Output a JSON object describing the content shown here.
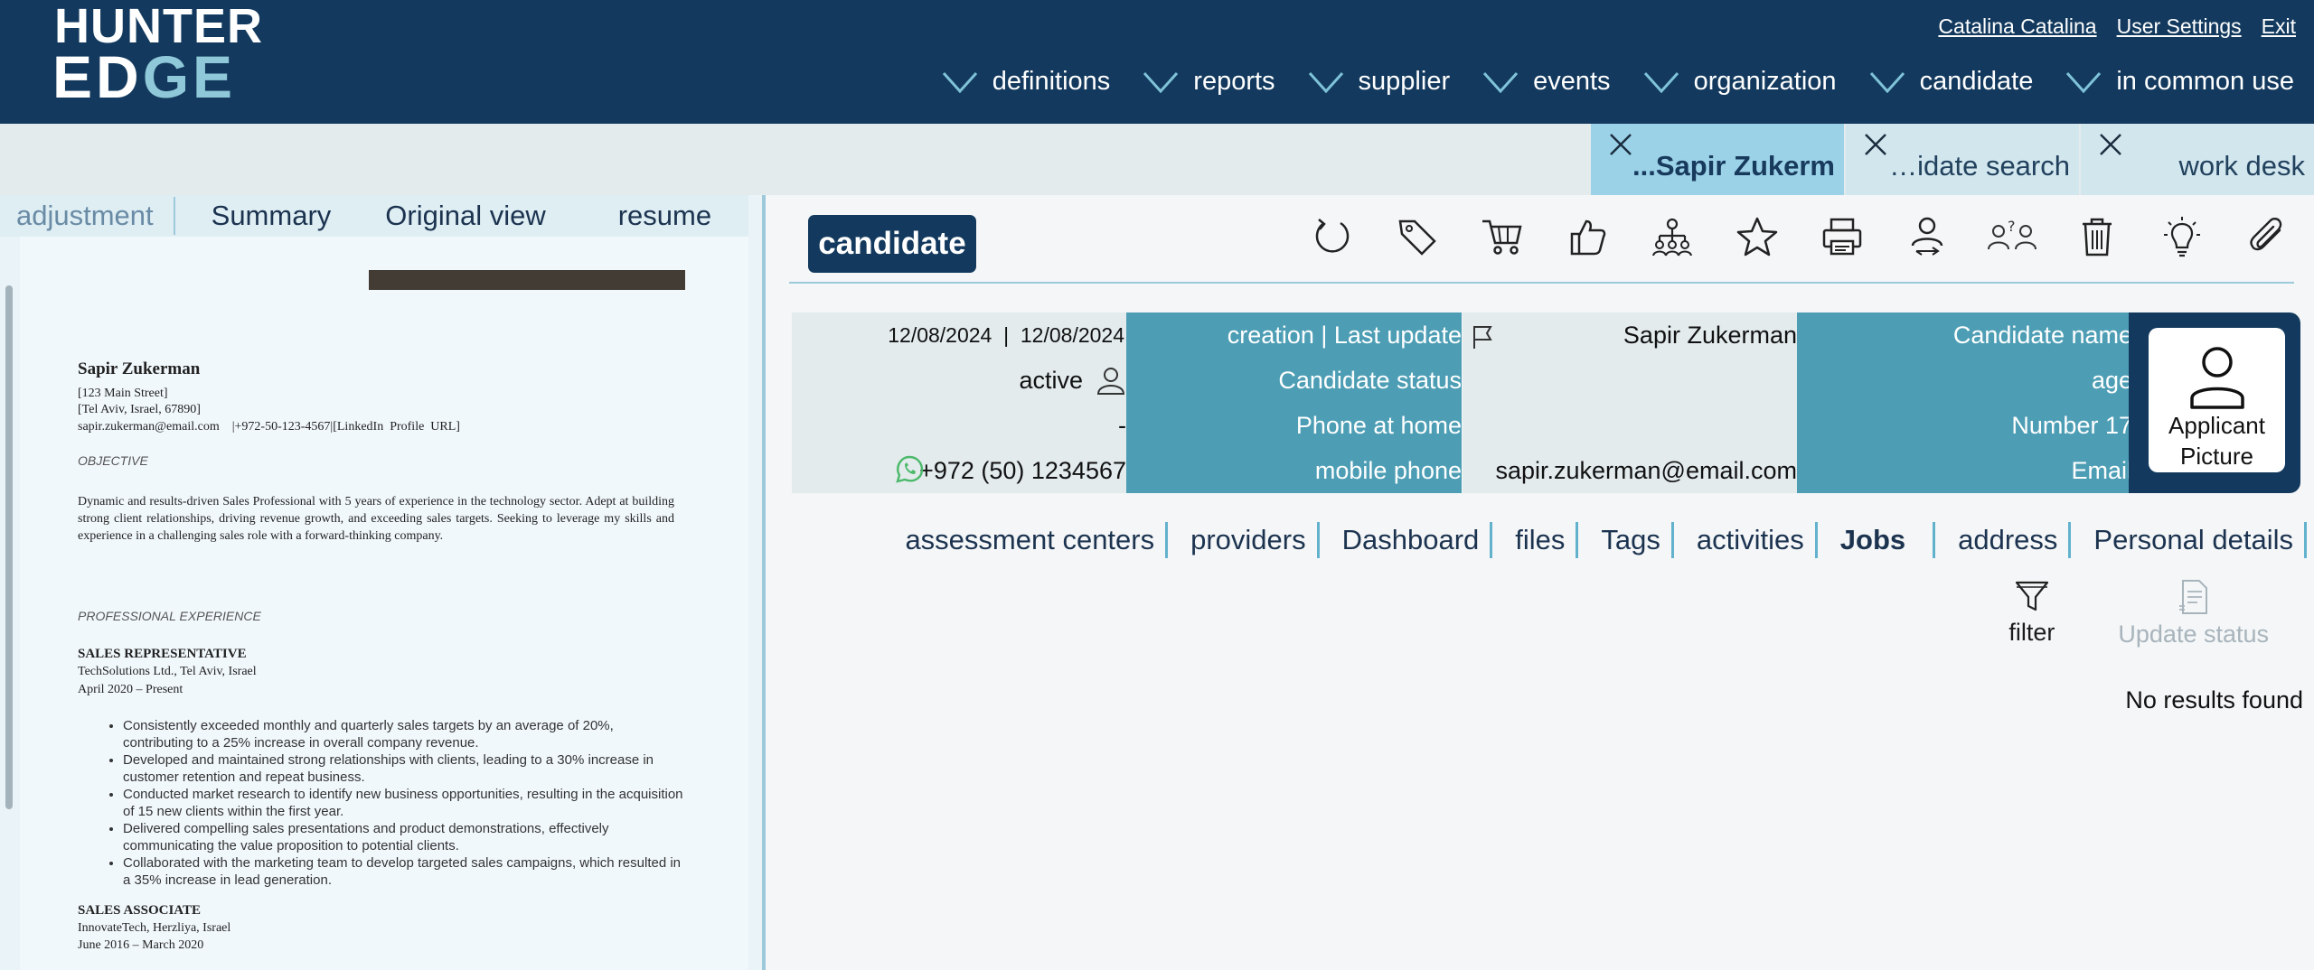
{
  "logo": {
    "line1": "HUNTER",
    "line2a": "ED",
    "line2b": "GE"
  },
  "user": {
    "name": "Catalina Catalina",
    "settings": "User Settings",
    "exit": "Exit"
  },
  "nav": [
    "definitions",
    "reports",
    "supplier",
    "events",
    "organization",
    "candidate",
    "in common use"
  ],
  "open_tabs": [
    {
      "label": "...Sapir Zukerm",
      "active": true
    },
    {
      "label": "…idate search",
      "active": false
    },
    {
      "label": "work desk",
      "active": false
    }
  ],
  "left_tabs": [
    "adjustment",
    "Summary",
    "Original view",
    "resume"
  ],
  "resume": {
    "name": "Sapir Zukerman",
    "address": "[123 Main Street]",
    "city": "[Tel Aviv, Israel, 67890]",
    "contact": "sapir.zukerman@email.com    |+972-50-123-4567|[LinkedIn  Profile  URL]",
    "objective_title": "OBJECTIVE",
    "objective": "Dynamic and results-driven Sales Professional with 5 years of experience in the technology sector. Adept at building strong client relationships, driving revenue growth, and exceeding sales targets. Seeking to leverage my skills and experience in a challenging sales role with a forward-thinking company.",
    "experience_title": "PROFESSIONAL EXPERIENCE",
    "job1_title": "SALES REPRESENTATIVE",
    "job1_company": "TechSolutions  Ltd., Tel Aviv, Israel",
    "job1_dates": "April  2020 – Present",
    "job1_bullets": [
      "Consistently exceeded monthly and quarterly sales targets by an average of 20%, contributing to a 25% increase in overall company revenue.",
      "Developed and maintained strong relationships with clients, leading to a 30% increase in customer retention and repeat business.",
      "Conducted market research to identify new business opportunities, resulting in the acquisition of 15 new clients within the first year.",
      "Delivered compelling sales presentations and product demonstrations, effectively communicating the value proposition to potential clients.",
      "Collaborated with the marketing team to develop targeted sales campaigns, which resulted in a 35% increase in lead generation."
    ],
    "job2_title": "SALES ASSOCIATE",
    "job2_company": "InnovateTech,  Herzliya,  Israel",
    "job2_dates": "June 2016 – March 2020"
  },
  "candidate": {
    "header": "candidate",
    "dates": "12/08/2024  |  12/08/2024",
    "dates_label": "creation | Last update",
    "name": "Sapir Zukerman",
    "name_label": "Candidate name",
    "status": "active",
    "status_label": "Candidate status",
    "age_label": "age",
    "home_phone": "-",
    "home_phone_label": "Phone at home",
    "number_label": "Number 17",
    "mobile": "+972 (50) 1234567",
    "mobile_label": "mobile phone",
    "email": "sapir.zukerman@email.com",
    "email_label": "Email",
    "picture_line1": "Applicant",
    "picture_line2": "Picture"
  },
  "sections": [
    "assessment centers",
    "providers",
    "Dashboard",
    "files",
    "Tags",
    "activities",
    "Jobs",
    "address",
    "Personal details"
  ],
  "actions": {
    "filter": "filter",
    "update_status": "Update status"
  },
  "no_results": "No results found",
  "colors": {
    "navy": "#133a5e",
    "teal": "#4d9eb5",
    "light_teal": "#9bd2e8"
  }
}
